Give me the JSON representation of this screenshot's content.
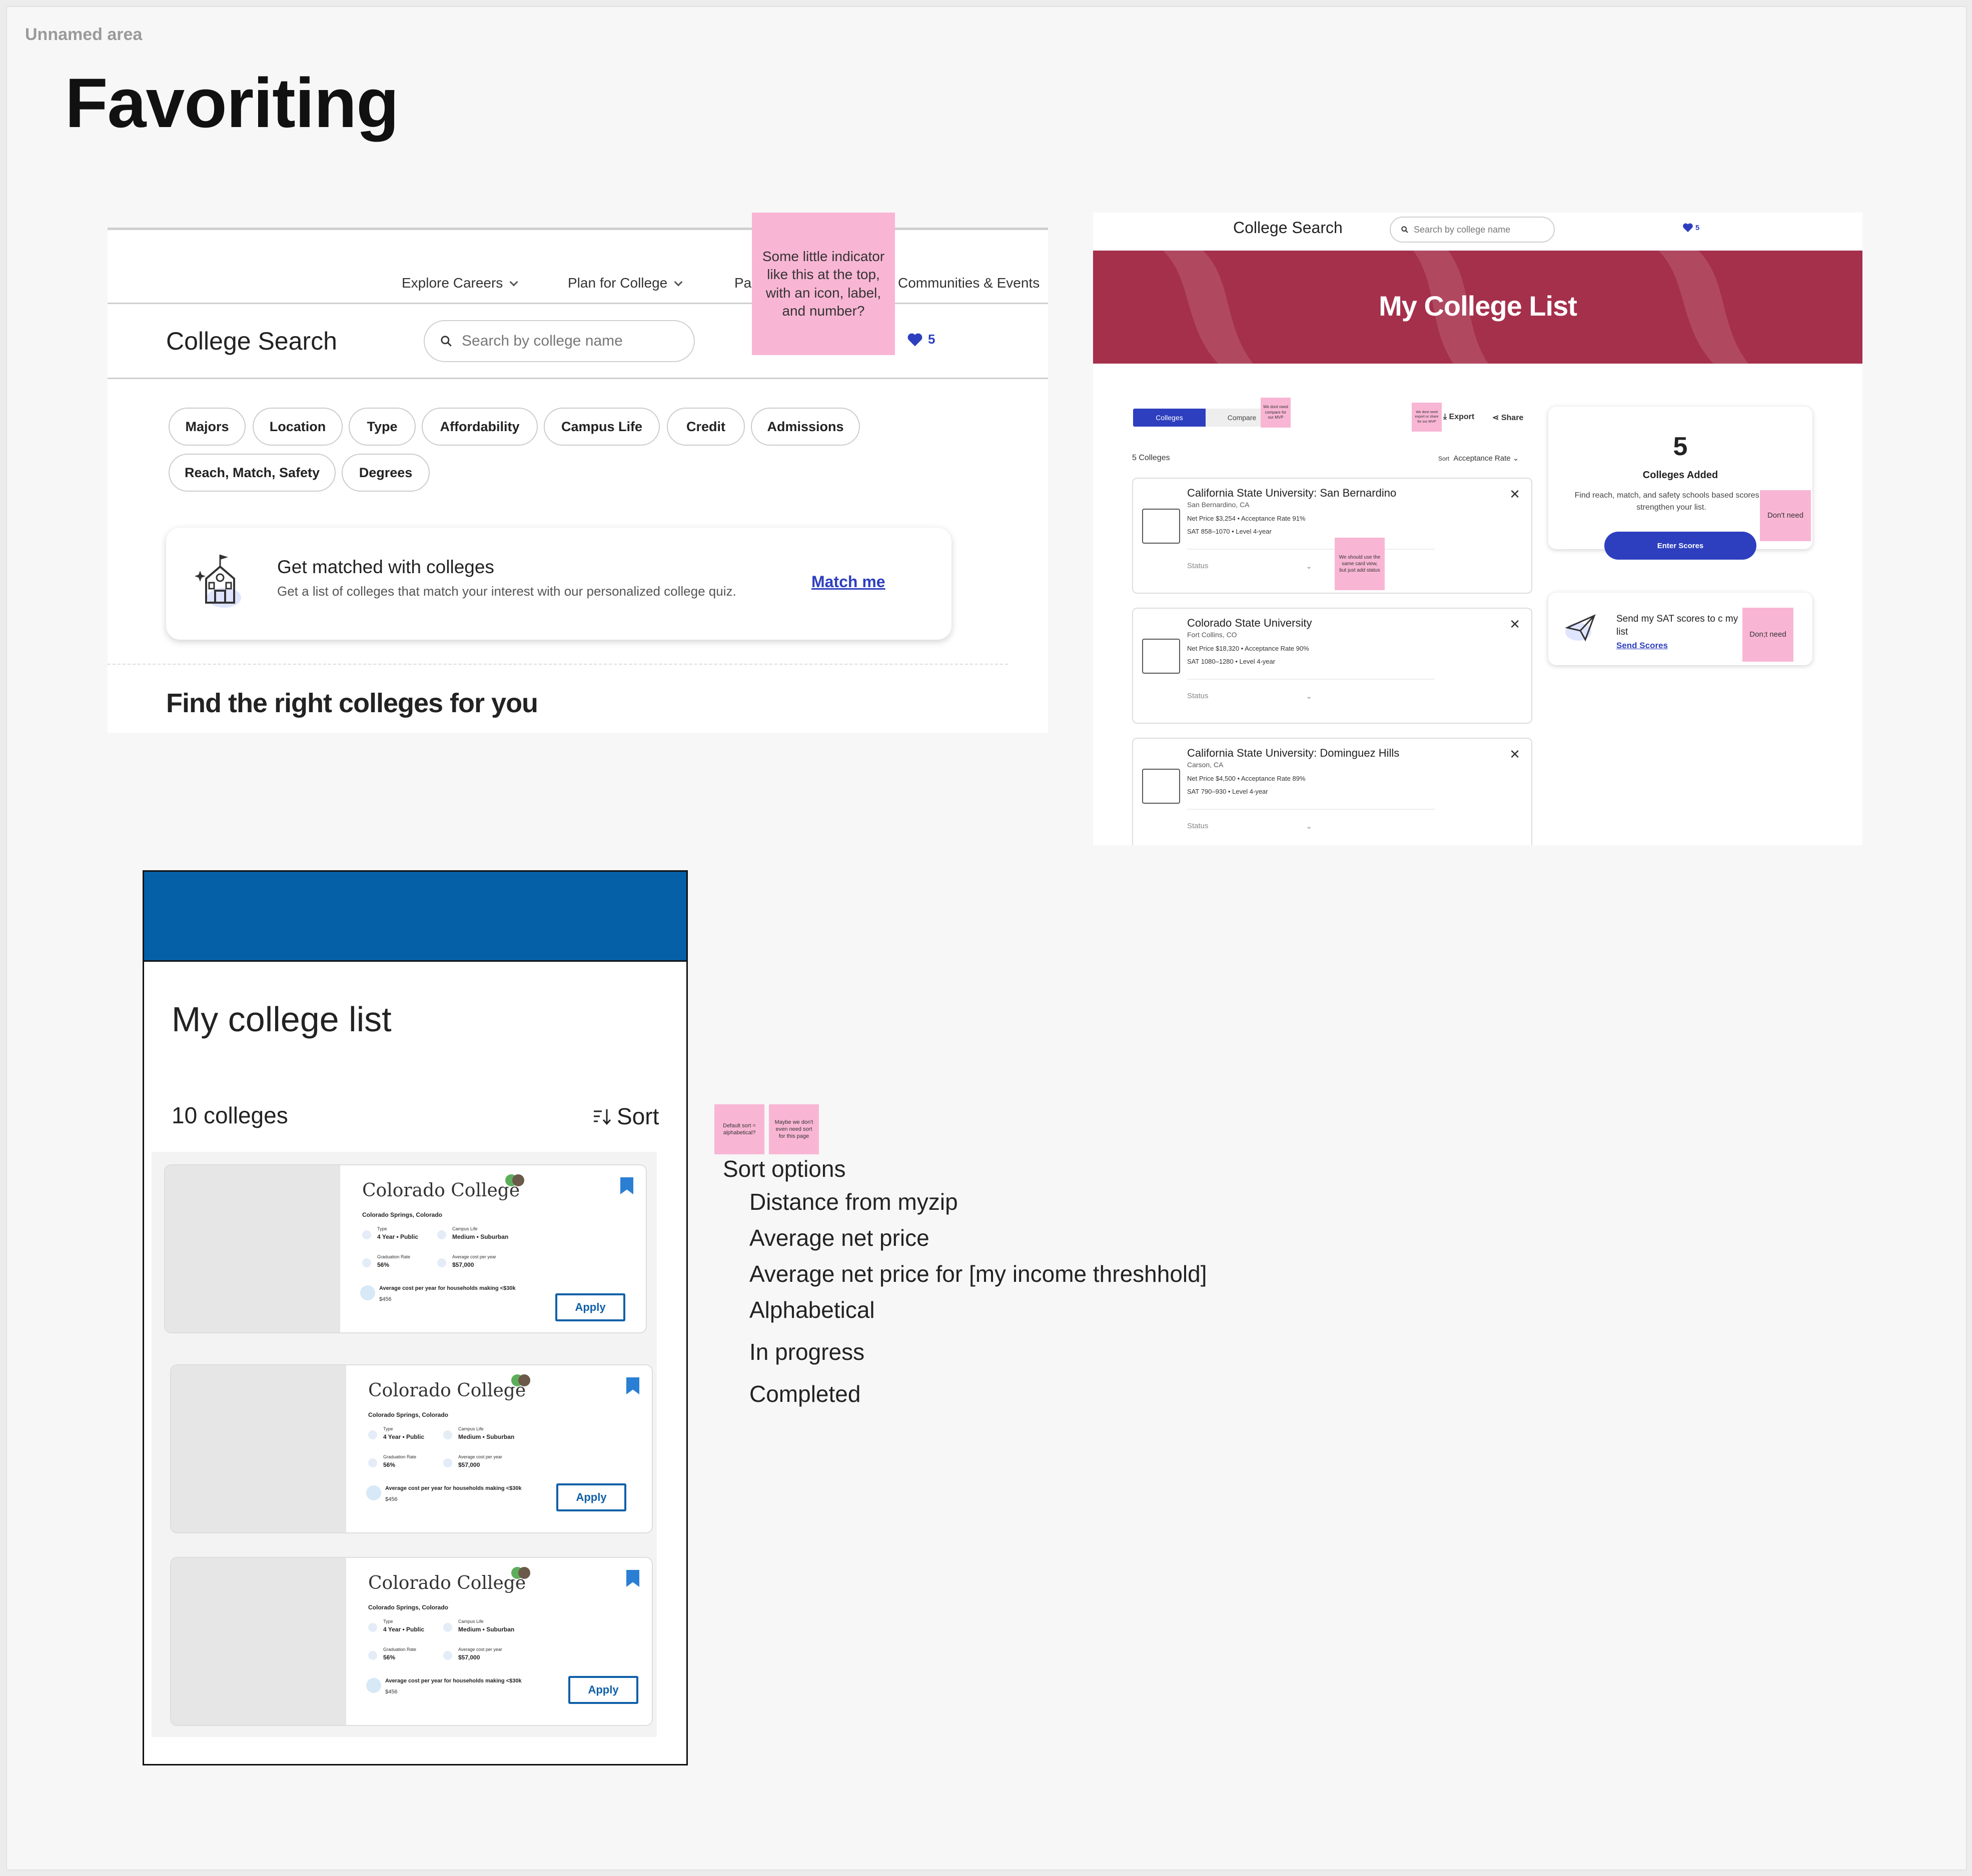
{
  "area_label": "Unnamed area",
  "title": "Favoriting",
  "frame1": {
    "nav": [
      "Explore Careers",
      "Plan for College",
      "Pa",
      "Communities & Events"
    ],
    "page_title": "College Search",
    "search_placeholder": "Search by college name",
    "fav_count": "5",
    "sticky_note": "Some little indicator like this at the top, with an icon, label, and number?",
    "filters_row1": [
      "Majors",
      "Location",
      "Type",
      "Affordability",
      "Campus Life",
      "Credit",
      "Admissions"
    ],
    "filters_row2": [
      "Reach, Match, Safety",
      "Degrees"
    ],
    "match": {
      "heading": "Get matched with colleges",
      "desc": "Get a list of colleges that match your interest with our personalized college quiz.",
      "link": "Match me"
    },
    "section_heading": "Find the right colleges for you"
  },
  "frame2": {
    "header_title": "College Search",
    "search_placeholder": "Search by college name",
    "fav_count": "5",
    "banner_title": "My College List",
    "tabs": [
      "Colleges",
      "Compare"
    ],
    "sticky_compare": "We dont need compare for our MVP",
    "sticky_export": "We dont need export or share for our MVP",
    "export_label": "Export",
    "share_label": "Share",
    "count_label": "5 Colleges",
    "sort_label": "Sort",
    "sort_value": "Acceptance Rate",
    "sticky_status": "We should use the same card view, but just add status",
    "colleges": [
      {
        "name": "California State University: San Bernardino",
        "location": "San Bernardino, CA",
        "line1": "Net Price $3,254 • Acceptance Rate 91%",
        "line2": "SAT 858–1070 • Level 4-year",
        "status": "Status"
      },
      {
        "name": "Colorado State University",
        "location": "Fort Collins, CO",
        "line1": "Net Price $18,320 • Acceptance Rate 90%",
        "line2": "SAT 1080–1280 • Level 4-year",
        "status": "Status"
      },
      {
        "name": "California State University: Dominguez Hills",
        "location": "Carson, CA",
        "line1": "Net Price $4,500 • Acceptance Rate 89%",
        "line2": "SAT 790–930 • Level 4-year",
        "status": "Status"
      }
    ],
    "added": {
      "number": "5",
      "label": "Colleges Added",
      "desc": "Find reach, match, and safety schools based scores to strengthen your list.",
      "button": "Enter Scores",
      "sticky": "Don't need"
    },
    "send": {
      "text": "Send my SAT scores to c my list",
      "link": "Send Scores",
      "sticky": "Don;t need"
    }
  },
  "frame3": {
    "title": "My college list",
    "count": "10 colleges",
    "sort_label": "Sort",
    "card": {
      "name": "Colorado College",
      "location": "Colorado Springs, Colorado",
      "type_label": "Type",
      "type_value": "4 Year • Public",
      "campus_label": "Campus Life",
      "campus_value": "Medium • Suburban",
      "grad_label": "Graduation Rate",
      "grad_value": "56%",
      "cost_label": "Average cost per year",
      "cost_value": "$57,000",
      "household_label": "Average cost per year for households making <$30k",
      "household_value": "$456",
      "apply": "Apply"
    }
  },
  "sort_notes": {
    "sticky1": "Default sort = alphabetical?",
    "sticky2": "Maybe we don't even need sort for this page",
    "heading": "Sort options",
    "options": [
      "Distance from myzip",
      "Average net price",
      "Average net price for [my income threshhold]",
      "Alphabetical",
      "In progress",
      "Completed"
    ]
  },
  "colors": {
    "accent_blue": "#2d3fbf",
    "banner_red": "#a5304b",
    "sticky_pink": "#f9b6d4",
    "frame3_header": "#0560a8"
  }
}
